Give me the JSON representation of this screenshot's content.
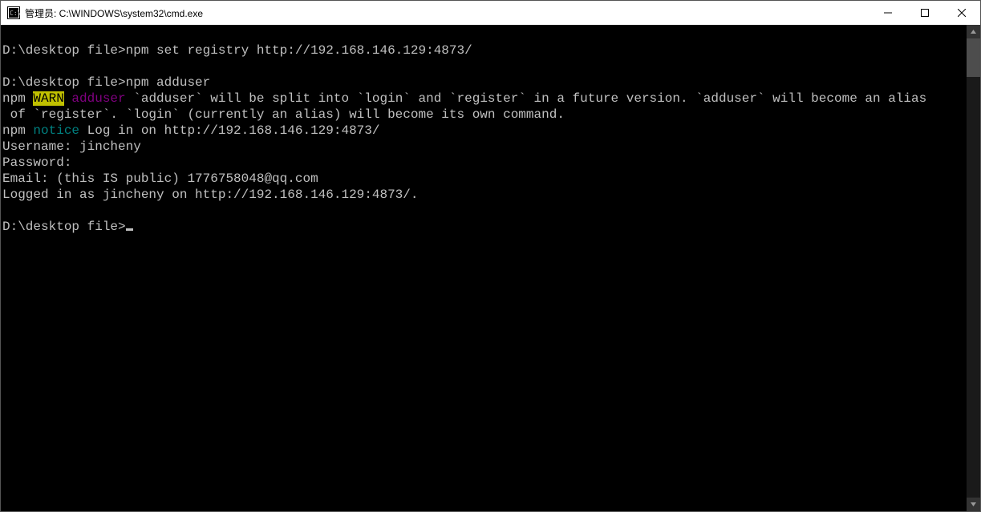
{
  "window": {
    "title": "管理员: C:\\WINDOWS\\system32\\cmd.exe"
  },
  "terminal": {
    "lines": [
      [
        {
          "text": ""
        }
      ],
      [
        {
          "text": "D:\\desktop file>npm set registry http://192.168.146.129:4873/"
        }
      ],
      [
        {
          "text": ""
        }
      ],
      [
        {
          "text": "D:\\desktop file>npm adduser"
        }
      ],
      [
        {
          "text": "npm "
        },
        {
          "text": "WARN",
          "cls": "warn-badge"
        },
        {
          "text": " "
        },
        {
          "text": "adduser",
          "cls": "magenta"
        },
        {
          "text": " `adduser` will be split into `login` and `register` in a future version. `adduser` will become an alias"
        }
      ],
      [
        {
          "text": " of `register`. `login` (currently an alias) will become its own command."
        }
      ],
      [
        {
          "text": "npm "
        },
        {
          "text": "notice",
          "cls": "teal"
        },
        {
          "text": " Log in on http://192.168.146.129:4873/"
        }
      ],
      [
        {
          "text": "Username: jincheny"
        }
      ],
      [
        {
          "text": "Password:"
        }
      ],
      [
        {
          "text": "Email: (this IS public) 1776758048@qq.com"
        }
      ],
      [
        {
          "text": "Logged in as jincheny on http://192.168.146.129:4873/."
        }
      ],
      [
        {
          "text": ""
        }
      ],
      [
        {
          "text": "D:\\desktop file>",
          "cursorAfter": true
        }
      ]
    ]
  }
}
